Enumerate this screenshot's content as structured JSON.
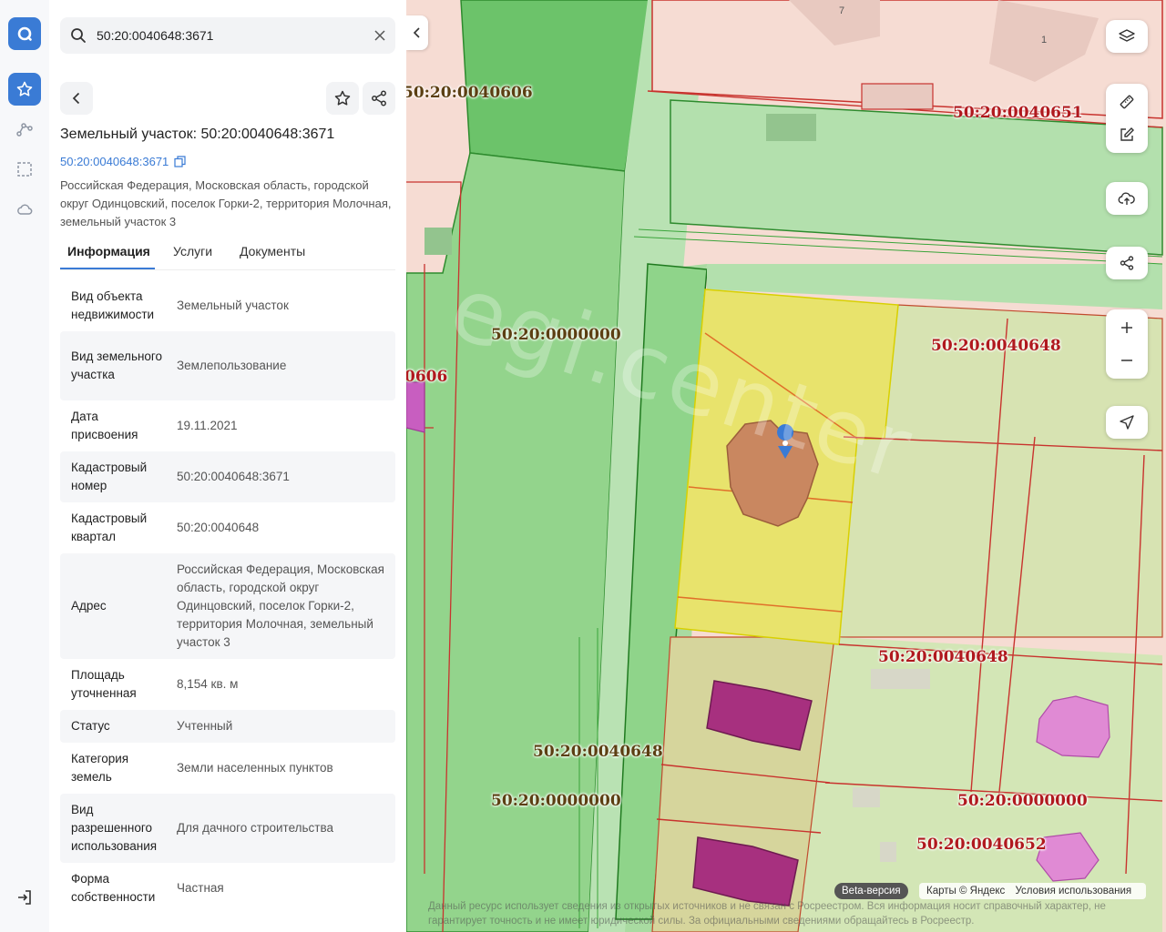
{
  "search": {
    "value": "50:20:0040648:3671"
  },
  "panel": {
    "title": "Земельный участок: 50:20:0040648:3671",
    "cad_number": "50:20:0040648:3671",
    "address": "Российская Федерация, Московская область, городской округ Одинцовский, поселок Горки-2, территория Молочная, земельный участок 3",
    "tabs": [
      "Информация",
      "Услуги",
      "Документы"
    ],
    "info": [
      {
        "k": "Вид объекта недвижимости",
        "v": "Земельный участок"
      },
      {
        "k": "Вид земельного участка",
        "v": "Землепользование"
      },
      {
        "k": "Дата присвоения",
        "v": "19.11.2021"
      },
      {
        "k": "Кадастровый номер",
        "v": "50:20:0040648:3671"
      },
      {
        "k": "Кадастровый квартал",
        "v": "50:20:0040648"
      },
      {
        "k": "Адрес",
        "v": "Российская Федерация, Московская область, городской округ Одинцовский, поселок Горки-2, территория Молочная, земельный участок 3"
      },
      {
        "k": "Площадь уточненная",
        "v": "8,154 кв. м"
      },
      {
        "k": "Статус",
        "v": "Учтенный"
      },
      {
        "k": "Категория земель",
        "v": "Земли населенных пунктов"
      },
      {
        "k": "Вид разрешенного использования",
        "v": "Для дачного строительства"
      },
      {
        "k": "Форма собственности",
        "v": "Частная"
      }
    ]
  },
  "map": {
    "labels": {
      "l1": "50:20:0040606",
      "l2": "50:20:0040651",
      "l3": "50:20:0000000",
      "l4": "50:20:0040648",
      "l5": "0606",
      "l6": "50:20:0040648",
      "l7": "50:20:0040648",
      "l8": "50:20:0000000",
      "l9": "50:20:0000000",
      "l10": "50:20:0040652"
    },
    "house_numbers": {
      "h1": "7",
      "h2": "1"
    },
    "watermark": "egi.center",
    "beta": "Beta-версия",
    "attribution": [
      "Карты © Яндекс",
      "Условия использования"
    ],
    "disclaimer": "Данный ресурс использует сведения из открытых источников и не связан с Росреестром. Вся информация носит справочный характер, не гарантирует точность и не имеет юридической силы. За официальными сведениями обращайтесь в Росреестр."
  },
  "colors": {
    "accent": "#3a7bd5",
    "selected_parcel": "#e8e36c",
    "green_zone": "#8fd48a",
    "building": "#a7307f"
  }
}
